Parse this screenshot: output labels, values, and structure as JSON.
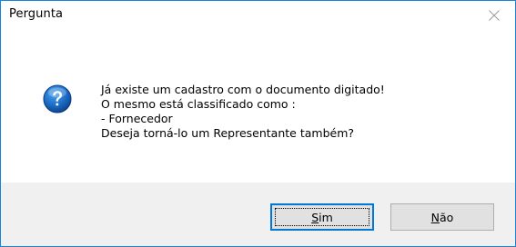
{
  "dialog": {
    "title": "Pergunta",
    "icon": "question-icon",
    "message_lines": [
      "Já existe um cadastro com o documento digitado!",
      "O mesmo está classificado como :",
      "- Fornecedor",
      "Deseja torná-lo um Representante também?"
    ],
    "buttons": {
      "yes": {
        "mnemonic": "S",
        "rest": "im"
      },
      "no": {
        "mnemonic": "N",
        "rest": "ão"
      }
    }
  },
  "colors": {
    "accent": "#0078d7",
    "window_border": "#1883d7",
    "footer_bg": "#f0f0f0",
    "button_bg": "#e1e1e1"
  }
}
